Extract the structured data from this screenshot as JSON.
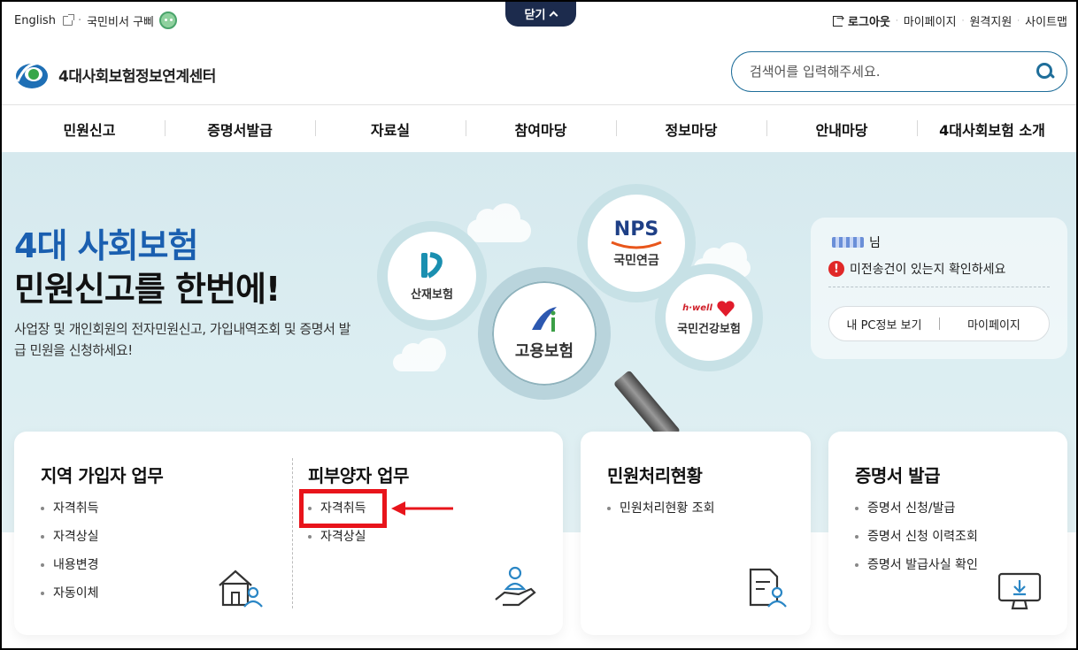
{
  "util": {
    "english": "English",
    "secretary": "국민비서 구삐",
    "close_tab": "닫기",
    "logout": "로그아웃",
    "mypage": "마이페이지",
    "remote": "원격지원",
    "sitemap": "사이트맵"
  },
  "logo": {
    "text": "4대사회보험정보연계센터"
  },
  "search": {
    "placeholder": "검색어를 입력해주세요."
  },
  "nav": [
    "민원신고",
    "증명서발급",
    "자료실",
    "참여마당",
    "정보마당",
    "안내마당",
    "4대사회보험 소개"
  ],
  "hero": {
    "title_line1": "4대 사회보험",
    "title_line2": "민원신고를 한번에!",
    "desc": "사업장 및 개인회원의 전자민원신고, 가입내역조회 및 증명서 발급 민원을 신청하세요!"
  },
  "bubbles": {
    "sanjae": "산재보험",
    "nps_logo": "NPS",
    "nps": "국민연금",
    "goyong": "고용보험",
    "hwell": "h·well",
    "health": "국민건강보험"
  },
  "user_panel": {
    "suffix": "님",
    "alert": "미전송건이 있는지 확인하세요",
    "btn_pc": "내 PC정보 보기",
    "btn_mypage": "마이페이지"
  },
  "cards": {
    "regional": {
      "title": "지역 가입자 업무",
      "items": [
        "자격취득",
        "자격상실",
        "내용변경",
        "자동이체"
      ]
    },
    "dependent": {
      "title": "피부양자 업무",
      "items": [
        "자격취득",
        "자격상실"
      ]
    },
    "status": {
      "title": "민원처리현황",
      "items": [
        "민원처리현황 조회"
      ]
    },
    "certificate": {
      "title": "증명서 발급",
      "items": [
        "증명서 신청/발급",
        "증명서 신청 이력조회",
        "증명서 발급사실 확인"
      ]
    }
  },
  "colors": {
    "brand": "#1a5fb0",
    "nav_dark": "#1c2b4d",
    "accent": "#1f6e9a",
    "highlight": "#e8141b"
  }
}
